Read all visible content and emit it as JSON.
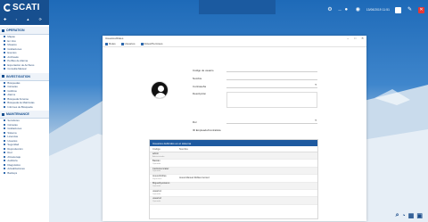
{
  "brand": {
    "name": "SCATI"
  },
  "topbar": {
    "user_label": "—",
    "datetime": "13/06/2019 11:51"
  },
  "sidebar": {
    "sections": [
      {
        "title": "OPERATION",
        "items": [
          "Mapas",
          "En Vivo",
          "Mosaico",
          "Grabaciones",
          "Eventos",
          "Archivado",
          "Perfiles de Alarma",
          "Exportación de Archivos",
          "Consulta Manual"
        ]
      },
      {
        "title": "INVESTIGATION",
        "items": [
          "Búsquedas",
          "Cámaras",
          "Gráficos",
          "Alarms",
          "Búsqueda Forense",
          "Búsqueda de Matrículas",
          "Informes de Búsqueda"
        ]
      },
      {
        "title": "MAINTENANCE",
        "items": [
          "Servidores",
          "Cámaras",
          "Grabaciones",
          "Sistema",
          "Licencias",
          "Usuarios",
          "Seguridad",
          "Reproducción",
          "Red",
          "Almacenaje",
          "Auditoría",
          "Diagnóstico",
          "Actualizaciones",
          "Backups"
        ]
      }
    ]
  },
  "dialog": {
    "title": "Usuarios/Roles",
    "toolbar": [
      "Roles",
      "Usuarios",
      "Roles/Permisos"
    ],
    "form": {
      "fields": [
        {
          "label": "Código de usuario",
          "value": ""
        },
        {
          "label": "Nombre",
          "value": ""
        },
        {
          "label": "Contraseña",
          "value": ""
        },
        {
          "label": "Descripción",
          "value": ""
        },
        {
          "label": "Rol",
          "value": ""
        },
        {
          "label": "ID Empleado/Contratista",
          "value": ""
        }
      ]
    },
    "table": {
      "title": "Usuarios definidos en el sistema",
      "columns": [
        "Código",
        "Nombre"
      ],
      "rows": [
        {
          "code": "admin",
          "sub": "Administrador",
          "name": ""
        },
        {
          "code": "Bastián",
          "sub": "Operador",
          "name": ""
        },
        {
          "code": "CarlosGonzalez",
          "sub": "Operador",
          "name": ""
        },
        {
          "code": "Jesus.Robles",
          "sub": "Supervisor",
          "name": "Jesus Manuel Robles Gomez"
        },
        {
          "code": "MiguelAyestaran",
          "sub": "Operador",
          "name": ""
        },
        {
          "code": "usuario1",
          "sub": "Operador",
          "name": ""
        },
        {
          "code": "usuario2",
          "sub": "Operador",
          "name": ""
        }
      ]
    }
  },
  "colors": {
    "primary": "#174f8f",
    "header_blue": "#1e5aa0",
    "close_red": "#e53935"
  }
}
